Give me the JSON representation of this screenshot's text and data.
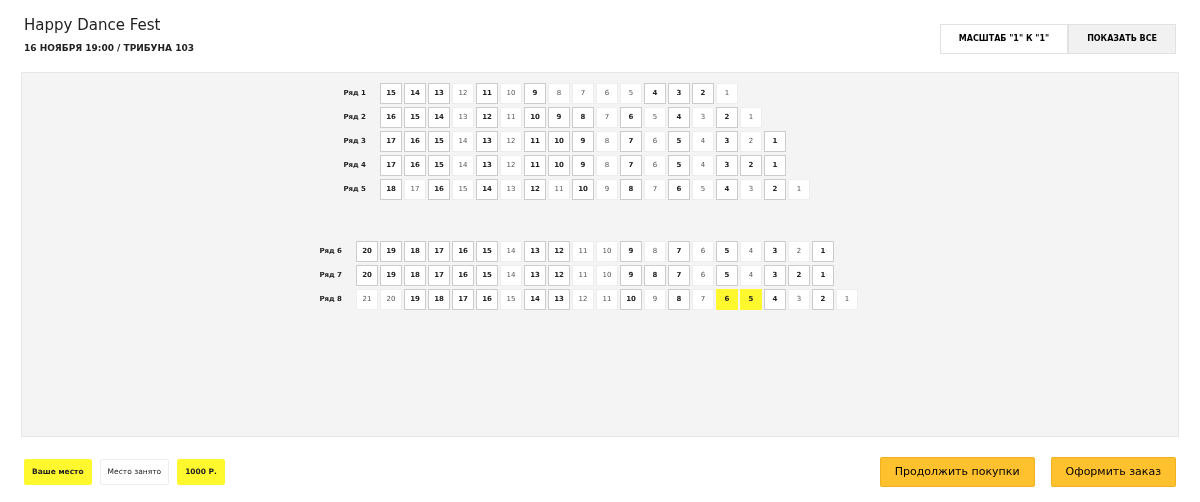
{
  "event": {
    "title": "Happy Dance Fest",
    "subtitle": "16 НОЯБРЯ 19:00 / ТРИБУНА 103"
  },
  "view_buttons": [
    {
      "label": "МАСШТАБ \"1\" К \"1\"",
      "selected": true
    },
    {
      "label": "ПОКАЗАТЬ ВСЕ",
      "selected": false
    }
  ],
  "sections": [
    {
      "rows": [
        {
          "label": "Ряд 1",
          "seats": [
            {
              "number": "15",
              "taken": false,
              "selected": false
            },
            {
              "number": "14",
              "taken": false,
              "selected": false
            },
            {
              "number": "13",
              "taken": false,
              "selected": false
            },
            {
              "number": "12",
              "taken": true,
              "selected": false
            },
            {
              "number": "11",
              "taken": false,
              "selected": false
            },
            {
              "number": "10",
              "taken": true,
              "selected": false
            },
            {
              "number": "9",
              "taken": false,
              "selected": false
            },
            {
              "number": "8",
              "taken": true,
              "selected": false
            },
            {
              "number": "7",
              "taken": true,
              "selected": false
            },
            {
              "number": "6",
              "taken": true,
              "selected": false
            },
            {
              "number": "5",
              "taken": true,
              "selected": false
            },
            {
              "number": "4",
              "taken": false,
              "selected": false
            },
            {
              "number": "3",
              "taken": false,
              "selected": false
            },
            {
              "number": "2",
              "taken": false,
              "selected": false
            },
            {
              "number": "1",
              "taken": true,
              "selected": false
            }
          ]
        },
        {
          "label": "Ряд 2",
          "seats": [
            {
              "number": "16",
              "taken": false,
              "selected": false
            },
            {
              "number": "15",
              "taken": false,
              "selected": false
            },
            {
              "number": "14",
              "taken": false,
              "selected": false
            },
            {
              "number": "13",
              "taken": true,
              "selected": false
            },
            {
              "number": "12",
              "taken": false,
              "selected": false
            },
            {
              "number": "11",
              "taken": true,
              "selected": false
            },
            {
              "number": "10",
              "taken": false,
              "selected": false
            },
            {
              "number": "9",
              "taken": false,
              "selected": false
            },
            {
              "number": "8",
              "taken": false,
              "selected": false
            },
            {
              "number": "7",
              "taken": true,
              "selected": false
            },
            {
              "number": "6",
              "taken": false,
              "selected": false
            },
            {
              "number": "5",
              "taken": true,
              "selected": false
            },
            {
              "number": "4",
              "taken": false,
              "selected": false
            },
            {
              "number": "3",
              "taken": true,
              "selected": false
            },
            {
              "number": "2",
              "taken": false,
              "selected": false
            },
            {
              "number": "1",
              "taken": true,
              "selected": false
            }
          ]
        },
        {
          "label": "Ряд 3",
          "seats": [
            {
              "number": "17",
              "taken": false,
              "selected": false
            },
            {
              "number": "16",
              "taken": false,
              "selected": false
            },
            {
              "number": "15",
              "taken": false,
              "selected": false
            },
            {
              "number": "14",
              "taken": true,
              "selected": false
            },
            {
              "number": "13",
              "taken": false,
              "selected": false
            },
            {
              "number": "12",
              "taken": true,
              "selected": false
            },
            {
              "number": "11",
              "taken": false,
              "selected": false
            },
            {
              "number": "10",
              "taken": false,
              "selected": false
            },
            {
              "number": "9",
              "taken": false,
              "selected": false
            },
            {
              "number": "8",
              "taken": true,
              "selected": false
            },
            {
              "number": "7",
              "taken": false,
              "selected": false
            },
            {
              "number": "6",
              "taken": true,
              "selected": false
            },
            {
              "number": "5",
              "taken": false,
              "selected": false
            },
            {
              "number": "4",
              "taken": true,
              "selected": false
            },
            {
              "number": "3",
              "taken": false,
              "selected": false
            },
            {
              "number": "2",
              "taken": true,
              "selected": false
            },
            {
              "number": "1",
              "taken": false,
              "selected": false
            }
          ]
        },
        {
          "label": "Ряд 4",
          "seats": [
            {
              "number": "17",
              "taken": false,
              "selected": false
            },
            {
              "number": "16",
              "taken": false,
              "selected": false
            },
            {
              "number": "15",
              "taken": false,
              "selected": false
            },
            {
              "number": "14",
              "taken": true,
              "selected": false
            },
            {
              "number": "13",
              "taken": false,
              "selected": false
            },
            {
              "number": "12",
              "taken": true,
              "selected": false
            },
            {
              "number": "11",
              "taken": false,
              "selected": false
            },
            {
              "number": "10",
              "taken": false,
              "selected": false
            },
            {
              "number": "9",
              "taken": false,
              "selected": false
            },
            {
              "number": "8",
              "taken": true,
              "selected": false
            },
            {
              "number": "7",
              "taken": false,
              "selected": false
            },
            {
              "number": "6",
              "taken": true,
              "selected": false
            },
            {
              "number": "5",
              "taken": false,
              "selected": false
            },
            {
              "number": "4",
              "taken": true,
              "selected": false
            },
            {
              "number": "3",
              "taken": false,
              "selected": false
            },
            {
              "number": "2",
              "taken": false,
              "selected": false
            },
            {
              "number": "1",
              "taken": false,
              "selected": false
            }
          ]
        },
        {
          "label": "Ряд 5",
          "seats": [
            {
              "number": "18",
              "taken": false,
              "selected": false
            },
            {
              "number": "17",
              "taken": true,
              "selected": false
            },
            {
              "number": "16",
              "taken": false,
              "selected": false
            },
            {
              "number": "15",
              "taken": true,
              "selected": false
            },
            {
              "number": "14",
              "taken": false,
              "selected": false
            },
            {
              "number": "13",
              "taken": true,
              "selected": false
            },
            {
              "number": "12",
              "taken": false,
              "selected": false
            },
            {
              "number": "11",
              "taken": true,
              "selected": false
            },
            {
              "number": "10",
              "taken": false,
              "selected": false
            },
            {
              "number": "9",
              "taken": true,
              "selected": false
            },
            {
              "number": "8",
              "taken": false,
              "selected": false
            },
            {
              "number": "7",
              "taken": true,
              "selected": false
            },
            {
              "number": "6",
              "taken": false,
              "selected": false
            },
            {
              "number": "5",
              "taken": true,
              "selected": false
            },
            {
              "number": "4",
              "taken": false,
              "selected": false
            },
            {
              "number": "3",
              "taken": true,
              "selected": false
            },
            {
              "number": "2",
              "taken": false,
              "selected": false
            },
            {
              "number": "1",
              "taken": true,
              "selected": false
            }
          ]
        }
      ]
    },
    {
      "rows": [
        {
          "label": "Ряд 6",
          "seats": [
            {
              "number": "20",
              "taken": false,
              "selected": false
            },
            {
              "number": "19",
              "taken": false,
              "selected": false
            },
            {
              "number": "18",
              "taken": false,
              "selected": false
            },
            {
              "number": "17",
              "taken": false,
              "selected": false
            },
            {
              "number": "16",
              "taken": false,
              "selected": false
            },
            {
              "number": "15",
              "taken": false,
              "selected": false
            },
            {
              "number": "14",
              "taken": true,
              "selected": false
            },
            {
              "number": "13",
              "taken": false,
              "selected": false
            },
            {
              "number": "12",
              "taken": false,
              "selected": false
            },
            {
              "number": "11",
              "taken": true,
              "selected": false
            },
            {
              "number": "10",
              "taken": true,
              "selected": false
            },
            {
              "number": "9",
              "taken": false,
              "selected": false
            },
            {
              "number": "8",
              "taken": true,
              "selected": false
            },
            {
              "number": "7",
              "taken": false,
              "selected": false
            },
            {
              "number": "6",
              "taken": true,
              "selected": false
            },
            {
              "number": "5",
              "taken": false,
              "selected": false
            },
            {
              "number": "4",
              "taken": true,
              "selected": false
            },
            {
              "number": "3",
              "taken": false,
              "selected": false
            },
            {
              "number": "2",
              "taken": true,
              "selected": false
            },
            {
              "number": "1",
              "taken": false,
              "selected": false
            }
          ]
        },
        {
          "label": "Ряд 7",
          "seats": [
            {
              "number": "20",
              "taken": false,
              "selected": false
            },
            {
              "number": "19",
              "taken": false,
              "selected": false
            },
            {
              "number": "18",
              "taken": false,
              "selected": false
            },
            {
              "number": "17",
              "taken": false,
              "selected": false
            },
            {
              "number": "16",
              "taken": false,
              "selected": false
            },
            {
              "number": "15",
              "taken": false,
              "selected": false
            },
            {
              "number": "14",
              "taken": true,
              "selected": false
            },
            {
              "number": "13",
              "taken": false,
              "selected": false
            },
            {
              "number": "12",
              "taken": false,
              "selected": false
            },
            {
              "number": "11",
              "taken": true,
              "selected": false
            },
            {
              "number": "10",
              "taken": true,
              "selected": false
            },
            {
              "number": "9",
              "taken": false,
              "selected": false
            },
            {
              "number": "8",
              "taken": false,
              "selected": false
            },
            {
              "number": "7",
              "taken": false,
              "selected": false
            },
            {
              "number": "6",
              "taken": true,
              "selected": false
            },
            {
              "number": "5",
              "taken": false,
              "selected": false
            },
            {
              "number": "4",
              "taken": true,
              "selected": false
            },
            {
              "number": "3",
              "taken": false,
              "selected": false
            },
            {
              "number": "2",
              "taken": false,
              "selected": false
            },
            {
              "number": "1",
              "taken": false,
              "selected": false
            }
          ]
        },
        {
          "label": "Ряд 8",
          "seats": [
            {
              "number": "21",
              "taken": true,
              "selected": false
            },
            {
              "number": "20",
              "taken": true,
              "selected": false
            },
            {
              "number": "19",
              "taken": false,
              "selected": false
            },
            {
              "number": "18",
              "taken": false,
              "selected": false
            },
            {
              "number": "17",
              "taken": false,
              "selected": false
            },
            {
              "number": "16",
              "taken": false,
              "selected": false
            },
            {
              "number": "15",
              "taken": true,
              "selected": false
            },
            {
              "number": "14",
              "taken": false,
              "selected": false
            },
            {
              "number": "13",
              "taken": false,
              "selected": false
            },
            {
              "number": "12",
              "taken": true,
              "selected": false
            },
            {
              "number": "11",
              "taken": true,
              "selected": false
            },
            {
              "number": "10",
              "taken": false,
              "selected": false
            },
            {
              "number": "9",
              "taken": true,
              "selected": false
            },
            {
              "number": "8",
              "taken": false,
              "selected": false
            },
            {
              "number": "7",
              "taken": true,
              "selected": false
            },
            {
              "number": "6",
              "taken": false,
              "selected": true
            },
            {
              "number": "5",
              "taken": false,
              "selected": true
            },
            {
              "number": "4",
              "taken": false,
              "selected": false
            },
            {
              "number": "3",
              "taken": true,
              "selected": false
            },
            {
              "number": "2",
              "taken": false,
              "selected": false
            },
            {
              "number": "1",
              "taken": true,
              "selected": false
            }
          ]
        }
      ]
    }
  ],
  "legend": [
    {
      "label": "Ваше место",
      "kind": "mine"
    },
    {
      "label": "Место занято",
      "kind": "taken"
    },
    {
      "label": "1000 Р.",
      "kind": "price"
    }
  ],
  "actions": [
    {
      "label": "Продолжить покупки"
    },
    {
      "label": "Оформить заказ"
    }
  ]
}
